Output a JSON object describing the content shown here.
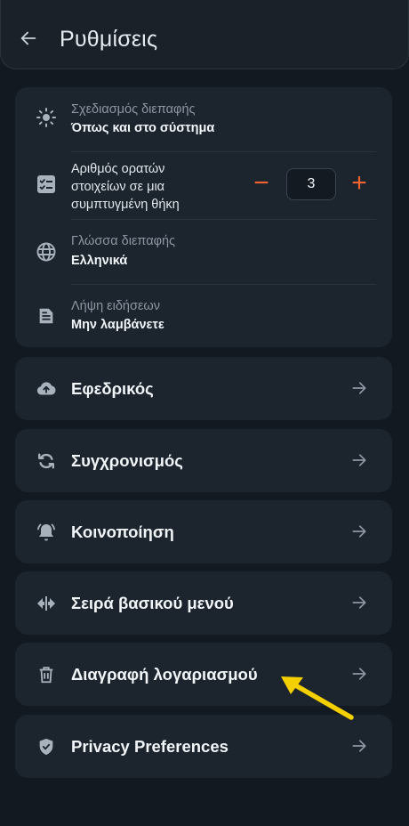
{
  "header": {
    "title": "Ρυθμίσεις",
    "back_icon": "arrow-left-icon"
  },
  "settings": {
    "interface_design": {
      "label": "Σχεδιασμός διεπαφής",
      "value": "Όπως και στο σύστημα",
      "icon": "brightness-icon"
    },
    "visible_items": {
      "label_line1": "Αριθμός ορατών",
      "label_line2": "στοιχείων σε μια",
      "label_line3": "συμπτυγμένη θήκη",
      "value": "3",
      "minus_label": "−",
      "plus_label": "+",
      "icon": "checklist-icon",
      "accent": "#f06230"
    },
    "language": {
      "label": "Γλώσσα διεπαφής",
      "value": "Ελληνικά",
      "icon": "globe-icon"
    },
    "news": {
      "label": "Λήψη ειδήσεων",
      "value": "Μην λαμβάνετε",
      "icon": "document-icon"
    }
  },
  "nav": [
    {
      "label": "Εφεδρικός",
      "icon": "cloud-upload-icon"
    },
    {
      "label": "Συγχρονισμός",
      "icon": "sync-icon"
    },
    {
      "label": "Κοινοποίηση",
      "icon": "bell-ring-icon"
    },
    {
      "label": "Σειρά βασικού μενού",
      "icon": "swap-arrows-icon"
    },
    {
      "label": "Διαγραφή λογαριασμού",
      "icon": "trash-icon"
    },
    {
      "label": "Privacy Preferences",
      "icon": "shield-check-icon"
    }
  ],
  "annotation": {
    "color": "#f5d000"
  }
}
